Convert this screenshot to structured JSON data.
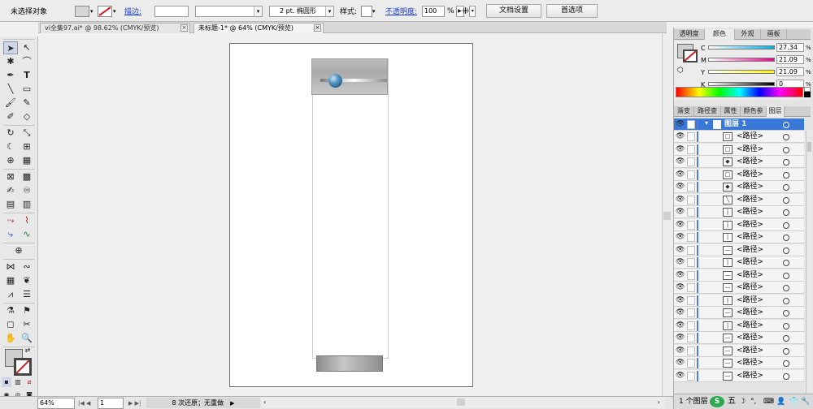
{
  "control_bar": {
    "selection_label": "未选择对象",
    "stroke_label": "描边:",
    "stroke_width_value": "",
    "brush_value": "2 pt. 椭圆形",
    "style_label": "样式:",
    "opacity_label": "不透明度:",
    "opacity_value": "100",
    "percent_sign": "%",
    "doc_setup_label": "文档设置",
    "preferences_label": "首选项"
  },
  "tabs": [
    {
      "label": "vi全集97.ai* @ 98.62% (CMYK/预览)",
      "close": "×"
    },
    {
      "label": "未标题-1* @ 64% (CMYK/预览)",
      "close": "×"
    }
  ],
  "statusbar": {
    "zoom": "64%",
    "page": "1",
    "undo_text": "8 次还原；无重做"
  },
  "color_panel": {
    "tabs": [
      "透明度",
      "颜色",
      "外观",
      "画板"
    ],
    "channels": [
      {
        "name": "C",
        "value": "27.34"
      },
      {
        "name": "M",
        "value": "21.09"
      },
      {
        "name": "Y",
        "value": "21.09"
      },
      {
        "name": "K",
        "value": "0"
      }
    ],
    "percent": "%"
  },
  "layers_panel": {
    "tabs": [
      "渐变",
      "路径查",
      "属性",
      "颜色参",
      "图层"
    ],
    "layer_name": "图层 1",
    "path_name": "<路径>",
    "path_count": 20,
    "footer": "1 个图层"
  },
  "colors": {
    "accent": "#3a78d8",
    "bottle_ball": "#2f6f9c",
    "link": "#1d3fd0"
  }
}
